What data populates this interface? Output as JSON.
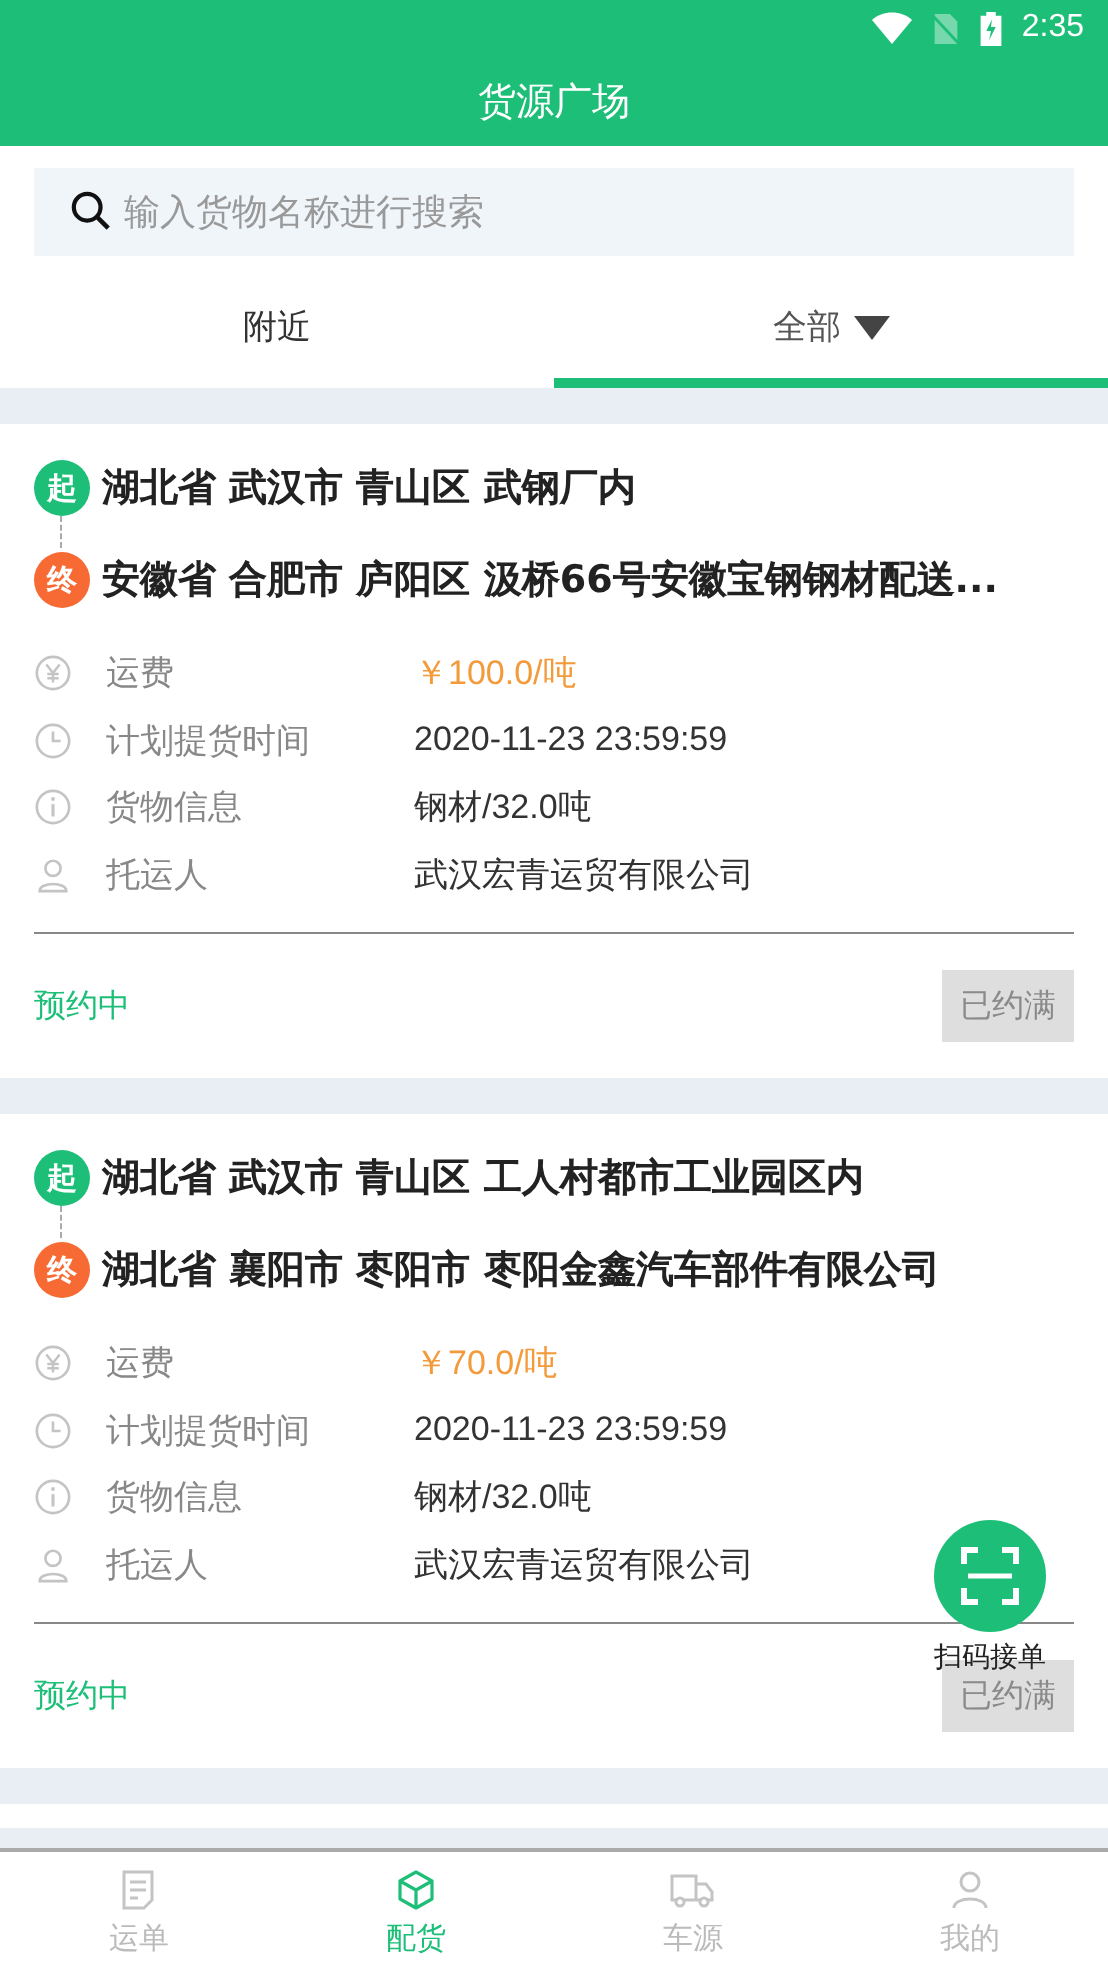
{
  "status_bar": {
    "time": "2:35"
  },
  "header": {
    "title": "货源广场"
  },
  "search": {
    "placeholder": "输入货物名称进行搜索"
  },
  "tabs": [
    {
      "label": "附近",
      "selected": false,
      "dropdown": false
    },
    {
      "label": "全部",
      "selected": true,
      "dropdown": true
    }
  ],
  "cards": [
    {
      "origin": {
        "badge": "起",
        "address": "湖北省 武汉市 青山区 武钢厂内"
      },
      "destination": {
        "badge": "终",
        "address": "安徽省 合肥市 庐阳区 汲桥66号安徽宝钢钢材配送..."
      },
      "rows": [
        {
          "kind": "fee",
          "label": "运费",
          "value": "￥100.0/吨"
        },
        {
          "kind": "time",
          "label": "计划提货时间",
          "value": "2020-11-23 23:59:59"
        },
        {
          "kind": "cargo",
          "label": "货物信息",
          "value": "钢材/32.0吨"
        },
        {
          "kind": "shipper",
          "label": "托运人",
          "value": "武汉宏青运贸有限公司"
        }
      ],
      "status": "预约中",
      "button": {
        "label": "已约满",
        "disabled": true
      }
    },
    {
      "origin": {
        "badge": "起",
        "address": "湖北省 武汉市 青山区 工人村都市工业园区内"
      },
      "destination": {
        "badge": "终",
        "address": "湖北省 襄阳市 枣阳市 枣阳金鑫汽车部件有限公司"
      },
      "rows": [
        {
          "kind": "fee",
          "label": "运费",
          "value": "￥70.0/吨"
        },
        {
          "kind": "time",
          "label": "计划提货时间",
          "value": "2020-11-23 23:59:59"
        },
        {
          "kind": "cargo",
          "label": "货物信息",
          "value": "钢材/32.0吨"
        },
        {
          "kind": "shipper",
          "label": "托运人",
          "value": "武汉宏青运贸有限公司"
        }
      ],
      "status": "预约中",
      "button": {
        "label": "已约满",
        "disabled": true
      }
    }
  ],
  "scan_button": {
    "label": "扫码接单"
  },
  "nav": [
    {
      "kind": "orders",
      "label": "运单",
      "selected": false
    },
    {
      "kind": "cargo",
      "label": "配货",
      "selected": true
    },
    {
      "kind": "trucks",
      "label": "车源",
      "selected": false
    },
    {
      "kind": "me",
      "label": "我的",
      "selected": false
    }
  ]
}
